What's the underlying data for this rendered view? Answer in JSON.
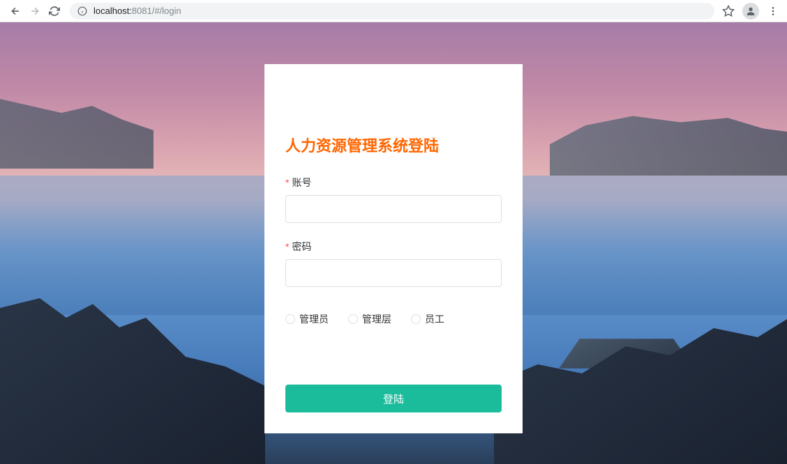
{
  "browser": {
    "url_host": "localhost:",
    "url_port_path": "8081/#/login"
  },
  "login": {
    "title": "人力资源管理系统登陆",
    "username_label": "账号",
    "password_label": "密码",
    "roles": {
      "admin": "管理员",
      "manager": "管理层",
      "employee": "员工"
    },
    "submit_label": "登陆"
  },
  "colors": {
    "accent": "#ff6600",
    "primary_button": "#1abc9c"
  }
}
